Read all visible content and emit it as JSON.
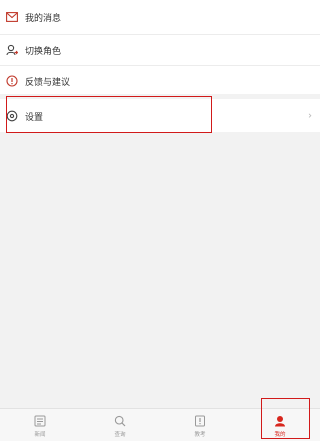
{
  "menu": {
    "items": [
      {
        "label": "我的消息",
        "icon": "mail-icon"
      },
      {
        "label": "切换角色",
        "icon": "user-switch-icon"
      },
      {
        "label": "反馈与建议",
        "icon": "feedback-icon"
      }
    ],
    "settings": {
      "label": "设置",
      "icon": "gear-icon"
    },
    "chevron": "›"
  },
  "tabbar": {
    "tabs": [
      {
        "label": "新闻",
        "icon": "news-icon"
      },
      {
        "label": "查询",
        "icon": "search-icon"
      },
      {
        "label": "教考",
        "icon": "exam-icon"
      },
      {
        "label": "我的",
        "icon": "profile-icon",
        "active": true
      }
    ]
  },
  "colors": {
    "accent": "#d7261d",
    "highlight": "#d11a1a"
  }
}
